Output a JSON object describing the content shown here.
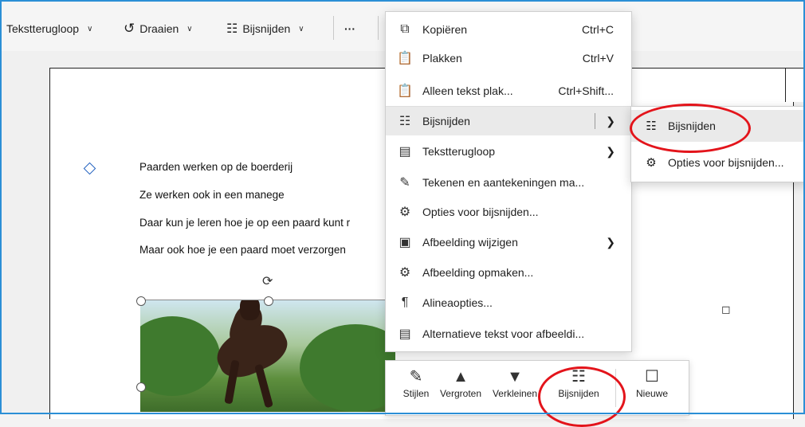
{
  "ribbon": {
    "text_wrap": "Tekstterugloop",
    "rotate": "Draaien",
    "crop": "Bijsnijden",
    "more": "···"
  },
  "document": {
    "lines": [
      "Paarden werken op de boerderij",
      "Ze werken ook in een manege",
      "Daar kun je leren hoe je op een paard kunt r",
      "Maar ook hoe je een paard moet verzorgen"
    ]
  },
  "context_menu": {
    "items": [
      {
        "label": "Kopiëren",
        "shortcut": "Ctrl+C",
        "icon": "copy-icon"
      },
      {
        "label": "Plakken",
        "shortcut": "Ctrl+V",
        "icon": "paste-icon"
      },
      {
        "label": "Alleen tekst plak...",
        "shortcut": "Ctrl+Shift...",
        "icon": "paste-text-icon"
      },
      {
        "label": "Bijsnijden",
        "icon": "crop-icon"
      },
      {
        "label": "Tekstterugloop",
        "icon": "wrap-text-icon"
      },
      {
        "label": "Tekenen en aantekeningen ma...",
        "icon": "draw-icon"
      },
      {
        "label": "Opties voor bijsnijden...",
        "icon": "crop-options-icon"
      },
      {
        "label": "Afbeelding wijzigen",
        "icon": "change-picture-icon"
      },
      {
        "label": "Afbeelding opmaken...",
        "icon": "format-picture-icon"
      },
      {
        "label": "Alineaopties...",
        "icon": "paragraph-icon"
      },
      {
        "label": "Alternatieve tekst voor afbeeldi...",
        "icon": "alt-text-icon"
      }
    ]
  },
  "submenu": {
    "items": [
      {
        "label": "Bijsnijden",
        "icon": "crop-icon"
      },
      {
        "label": "Opties voor bijsnijden...",
        "icon": "crop-options-icon"
      }
    ]
  },
  "mini_toolbar": {
    "styles": "Stijlen",
    "enlarge": "Vergroten",
    "shrink": "Verkleinen",
    "crop": "Bijsnijden",
    "new": "Nieuwe"
  },
  "colors": {
    "accent_border": "#2b8fd6",
    "highlight_circle": "#e3141b",
    "anchor_blue": "#1f5fbf"
  }
}
